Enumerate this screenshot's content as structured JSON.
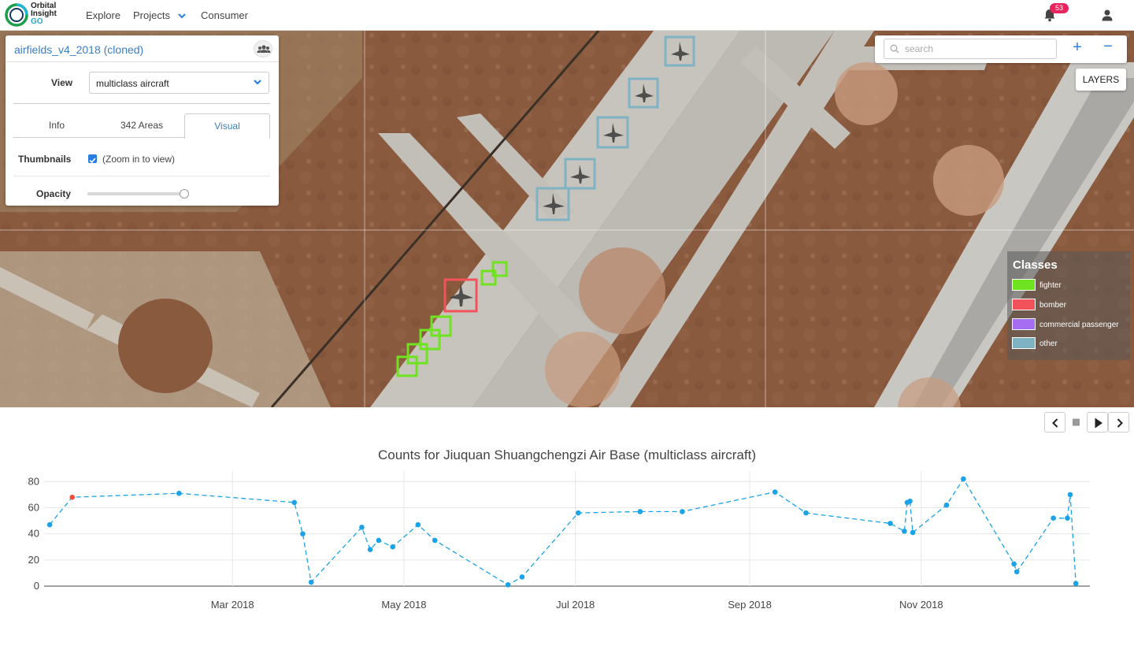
{
  "app": {
    "logo_line1": "Orbital",
    "logo_line2": "Insight",
    "logo_line3": "GO",
    "nav": [
      {
        "label": "Explore"
      },
      {
        "label": "Projects"
      },
      {
        "label": "Consumer"
      }
    ],
    "notification_count": "53"
  },
  "panel": {
    "title": "airfields_v4_2018 (cloned)",
    "view_label": "View",
    "view_value": "multiclass aircraft",
    "tabs": [
      {
        "label": "Info",
        "active": false
      },
      {
        "label": "342 Areas",
        "active": false
      },
      {
        "label": "Visual",
        "active": true
      }
    ],
    "thumbnails_label": "Thumbnails",
    "thumbnails_checked": true,
    "thumbnails_text": "(Zoom in to view)",
    "opacity_label": "Opacity",
    "opacity_value": 1.0
  },
  "map_controls": {
    "search_placeholder": "search",
    "zoom_in": "+",
    "zoom_out": "−",
    "layers_label": "LAYERS"
  },
  "legend": {
    "title": "Classes",
    "items": [
      {
        "label": "fighter",
        "color": "#6fe320"
      },
      {
        "label": "bomber",
        "color": "#f2525a"
      },
      {
        "label": "commercial passenger",
        "color": "#a66cf2"
      },
      {
        "label": "other",
        "color": "#7fb3c4"
      }
    ]
  },
  "colors": {
    "accent": "#2a7de1",
    "series": "#1aa3e6",
    "highlight_point": "#f04e38"
  },
  "chart_data": {
    "type": "line",
    "title": "Counts for Jiuquan Shuangchengzi Air Base (multiclass aircraft)",
    "xlabel": "",
    "ylabel": "",
    "x_tick_labels": [
      "Mar 2018",
      "May 2018",
      "Jul 2018",
      "Sep 2018",
      "Nov 2018"
    ],
    "x_tick_dates": [
      "2018-03-01",
      "2018-05-01",
      "2018-07-01",
      "2018-09-01",
      "2018-11-01"
    ],
    "y_ticks": [
      0,
      20,
      40,
      60,
      80
    ],
    "xlim": [
      "2017-12-24",
      "2018-12-31"
    ],
    "ylim": [
      0,
      88
    ],
    "grid": true,
    "line_style": "dashed",
    "highlighted_point": {
      "x": "2018-01-03",
      "y": 68
    },
    "series": [
      {
        "values": [
          {
            "x": "2017-12-26",
            "y": 47
          },
          {
            "x": "2018-01-03",
            "y": 68
          },
          {
            "x": "2018-02-10",
            "y": 71
          },
          {
            "x": "2018-03-23",
            "y": 64
          },
          {
            "x": "2018-03-26",
            "y": 40
          },
          {
            "x": "2018-03-29",
            "y": 3
          },
          {
            "x": "2018-04-16",
            "y": 45
          },
          {
            "x": "2018-04-19",
            "y": 28
          },
          {
            "x": "2018-04-22",
            "y": 35
          },
          {
            "x": "2018-04-27",
            "y": 30
          },
          {
            "x": "2018-05-06",
            "y": 47
          },
          {
            "x": "2018-05-12",
            "y": 35
          },
          {
            "x": "2018-06-07",
            "y": 1
          },
          {
            "x": "2018-06-12",
            "y": 7
          },
          {
            "x": "2018-07-02",
            "y": 56
          },
          {
            "x": "2018-07-24",
            "y": 57
          },
          {
            "x": "2018-08-08",
            "y": 57
          },
          {
            "x": "2018-09-10",
            "y": 72
          },
          {
            "x": "2018-09-21",
            "y": 56
          },
          {
            "x": "2018-10-21",
            "y": 48
          },
          {
            "x": "2018-10-26",
            "y": 42
          },
          {
            "x": "2018-10-27",
            "y": 64
          },
          {
            "x": "2018-10-28",
            "y": 65
          },
          {
            "x": "2018-10-29",
            "y": 41
          },
          {
            "x": "2018-11-10",
            "y": 62
          },
          {
            "x": "2018-11-16",
            "y": 82
          },
          {
            "x": "2018-12-04",
            "y": 17
          },
          {
            "x": "2018-12-05",
            "y": 11
          },
          {
            "x": "2018-12-18",
            "y": 52
          },
          {
            "x": "2018-12-23",
            "y": 52
          },
          {
            "x": "2018-12-24",
            "y": 70
          },
          {
            "x": "2018-12-26",
            "y": 2
          }
        ]
      }
    ]
  }
}
